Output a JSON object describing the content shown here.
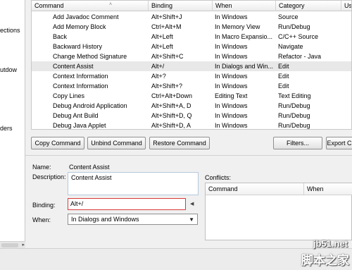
{
  "left_pane": {
    "labels": [
      "ections",
      "utdow",
      "ders"
    ]
  },
  "table": {
    "headers": [
      "Command",
      "Binding",
      "When",
      "Category",
      "Use"
    ],
    "rows": [
      {
        "command": "Add Javadoc Comment",
        "binding": "Alt+Shift+J",
        "when": "In Windows",
        "category": "Source"
      },
      {
        "command": "Add Memory Block",
        "binding": "Ctrl+Alt+M",
        "when": "In Memory View",
        "category": "Run/Debug"
      },
      {
        "command": "Back",
        "binding": "Alt+Left",
        "when": "In Macro Expansio...",
        "category": "C/C++ Source"
      },
      {
        "command": "Backward History",
        "binding": "Alt+Left",
        "when": "In Windows",
        "category": "Navigate"
      },
      {
        "command": "Change Method Signature",
        "binding": "Alt+Shift+C",
        "when": "In Windows",
        "category": "Refactor - Java"
      },
      {
        "command": "Content Assist",
        "binding": "Alt+/",
        "when": "In Dialogs and Win...",
        "category": "Edit",
        "selected": true
      },
      {
        "command": "Context Information",
        "binding": "Alt+?",
        "when": "In Windows",
        "category": "Edit"
      },
      {
        "command": "Context Information",
        "binding": "Alt+Shift+?",
        "when": "In Windows",
        "category": "Edit"
      },
      {
        "command": "Copy Lines",
        "binding": "Ctrl+Alt+Down",
        "when": "Editing Text",
        "category": "Text Editing"
      },
      {
        "command": "Debug Android Application",
        "binding": "Alt+Shift+A, D",
        "when": "In Windows",
        "category": "Run/Debug"
      },
      {
        "command": "Debug Ant Build",
        "binding": "Alt+Shift+D, Q",
        "when": "In Windows",
        "category": "Run/Debug"
      },
      {
        "command": "Debug Java Applet",
        "binding": "Alt+Shift+D, A",
        "when": "In Windows",
        "category": "Run/Debug"
      }
    ]
  },
  "buttons": {
    "copy": "Copy Command",
    "unbind": "Unbind Command",
    "restore": "Restore Command",
    "filters": "Filters...",
    "export": "Export C"
  },
  "details": {
    "name_label": "Name:",
    "name_value": "Content Assist",
    "description_label": "Description:",
    "description_value": "Content Assist",
    "binding_label": "Binding:",
    "binding_value": "Alt+/",
    "when_label": "When:",
    "when_value": "In Dialogs and Windows"
  },
  "conflicts": {
    "label": "Conflicts:",
    "headers": [
      "Command",
      "When"
    ]
  },
  "watermark": {
    "url": "jb51.net",
    "text": "脚本之家"
  },
  "colors": {
    "selection": "#e8e8e8",
    "binding_highlight": "#d93a3a"
  }
}
